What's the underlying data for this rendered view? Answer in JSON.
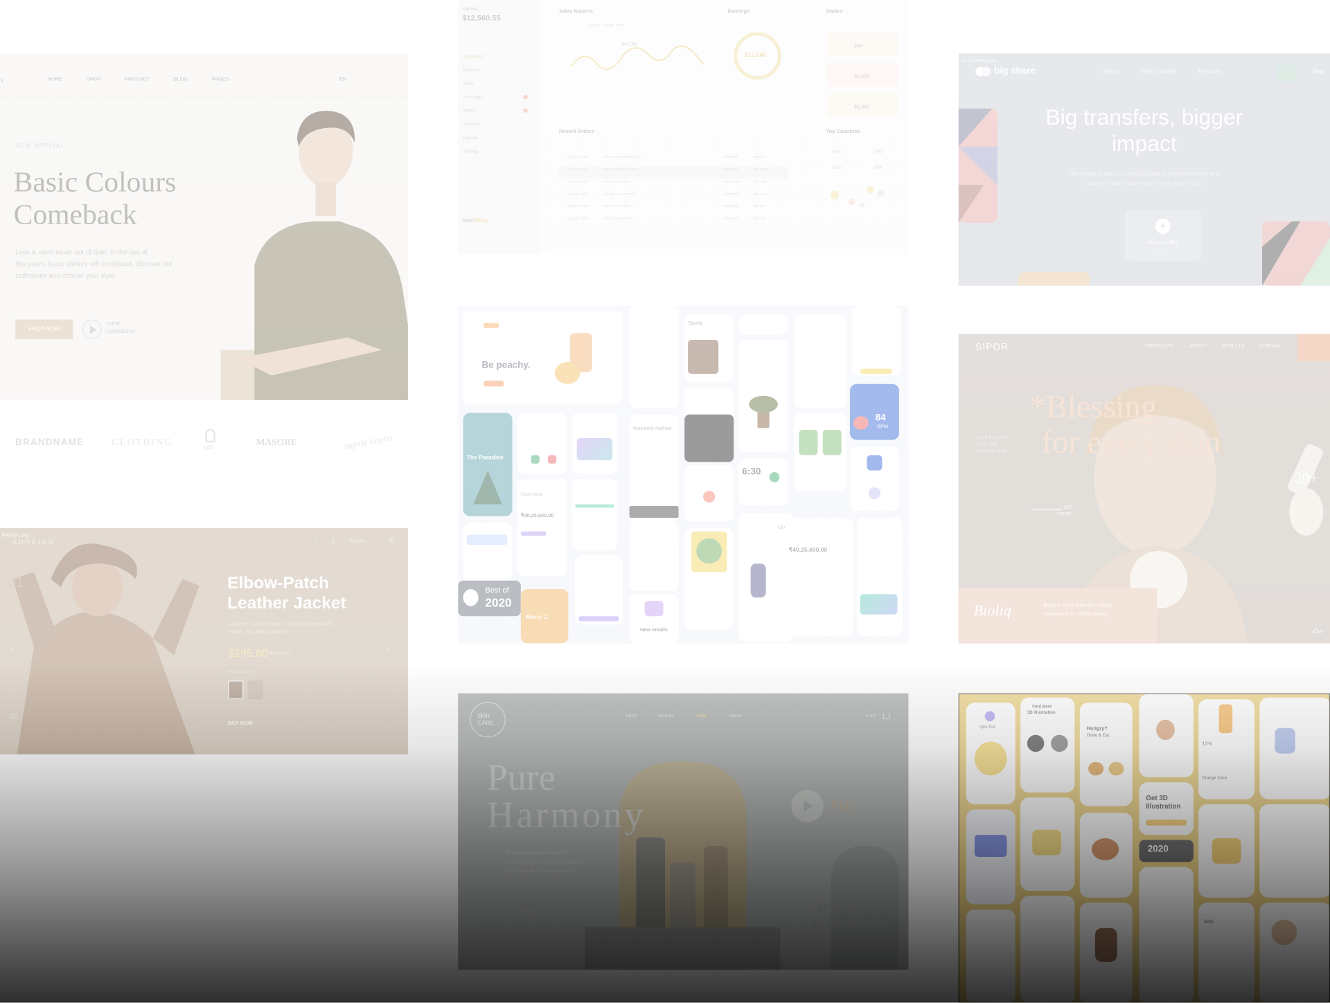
{
  "fashion": {
    "nav": [
      "HOME",
      "SHOP",
      "PRODUCT",
      "BLOG",
      "PAGES"
    ],
    "lang": "EN",
    "eyebrow": "NEW ARRIVAL",
    "title_line1": "Basic Colours",
    "title_line2": "Comeback",
    "body_l1": "Less is more never out of date. In the last of",
    "body_l2": "this years, basic colours will comeback, discover our",
    "body_l3": "collections and choose your style",
    "cta": "SHOP NOW",
    "lookbook_l1": "VIEW",
    "lookbook_l2": "LOOKBOOK",
    "brands": [
      "BRANDNAME",
      "CLOTHING",
      "gap",
      "MASORE",
      "supra unero"
    ]
  },
  "dashboard": {
    "balance_label": "Earning",
    "balance": "$12,560.55",
    "sidebar": [
      "Dashboard",
      "Products",
      "Sales",
      "Messages",
      "Orders",
      "Analytics",
      "Payouts",
      "Settings"
    ],
    "logo_a": "mart",
    "logo_b": "flexy",
    "sales_title": "Sales Reports",
    "sales_range": "Aug 15 - Aug 26, 2020",
    "peak": "$47,050",
    "earnings_title": "Earnings",
    "earnings_value": "$12,560",
    "statics_title": "Statics",
    "stats": [
      {
        "v": "254"
      },
      {
        "v": "$6,260"
      },
      {
        "v": "$2,567"
      }
    ],
    "orders_title": "Recent Orders",
    "orders_dates": [
      "Aug 15, 2020",
      "Aug 16, 2020",
      "Aug 15, 2020",
      "Aug 16, 2020",
      "Aug 15, 2020",
      "Aug 16, 2020"
    ],
    "orders_items": [
      "Green Bomber Military Ja",
      "Wanted Leather Jacket",
      "Crew Neck T-Shirt",
      "Pro Merch Crewneck",
      "Crew Neck T-Shirt",
      "Basic Graph T-shirt"
    ],
    "orders_status": [
      "Delivered",
      "Delivered",
      "In Progress",
      "Delivered",
      "Delivered",
      "Delivered"
    ],
    "orders_amount": [
      "$99.00",
      "$2,328.00",
      "$722.00",
      "$449.00",
      "$32.00",
      "$18.00"
    ],
    "countries_title": "Top Countries",
    "countries_pct": [
      "80%",
      "37%",
      "51%",
      "33%"
    ]
  },
  "share": {
    "file_tag": "Dustin Photos.png",
    "logo": "big share",
    "nav": [
      "About",
      "How it works",
      "Features"
    ],
    "signin": "Sign",
    "title_l1": "Big transfers, bigger",
    "title_l2": "impact",
    "sub_l1": "The simplest way to send big ideas around the world, and",
    "sub_l2": "discover new creative work while you're at it.",
    "add": "Add your files",
    "add_sub": "Up to 20 GB"
  },
  "collage": {
    "peachy": "Be peachy.",
    "paradise": "The Paradise",
    "overview": "Overview",
    "amount": "₹40,25,600.00",
    "sports": "Sports",
    "welcome": "Welcome Nathan",
    "best_l1": "Best of",
    "best_l2": "2020",
    "time": "6:30",
    "bpm": "84",
    "bpm_unit": "BPM",
    "new_emails": "New emails",
    "overview2": "Overview",
    "amount2": "₹40,25,600.00",
    "merry": "Merry J"
  },
  "skin": {
    "logo": "SIPOR",
    "nav": [
      "PRODUCTS",
      "ABOUT",
      "RESULTS",
      "JOURNAL"
    ],
    "title_l1": "*Blessing",
    "title_l2": "for every skin",
    "side_l1": "YOUR BEAUTY'S",
    "side_l2": "CARE FOR",
    "side_l3": "PERFECT SKIN",
    "get_l1": "GET",
    "get_l2": "YOURS",
    "badge": "20+",
    "brand": "Bioliq",
    "brand_desc_l1": "Bioliq is a our patented unique",
    "brand_desc_l2": "component for 100% beauty",
    "corner": "Our"
  },
  "jacket": {
    "file_tag": "Mockup 1.png",
    "logo": "ADORIAN",
    "cart": "$190.00",
    "title_l1": "Elbow-Patch",
    "title_l2": "Leather Jacket",
    "desc_l1": "Lambskin. Short design. 100% water-repellent",
    "desc_l2": "Suede. Buy elbow patches.",
    "price": "$195.00",
    "old_price": "$260.00",
    "more": "MORE COLORS",
    "buy": "BUY NOW",
    "slide_l": "01",
    "slide_r": "02"
  },
  "pure": {
    "logo_l1": "skin",
    "logo_l2": "CARE",
    "nav": [
      "Shop",
      "Beauty",
      "Sale",
      "About"
    ],
    "cart": "Cart",
    "title_l1": "Pure",
    "title_l2": "Harmony",
    "sub_l1": "Shop the Beauty trends for",
    "sub_l2": "customizing our Shea body butters",
    "sub_l3": "for a full rush in rush hour time",
    "play": "Play",
    "cta": "Discover",
    "tag_l1": "Anti-aging",
    "tag_l2": "neck cream"
  },
  "threed": {
    "find_l1": "Find Best",
    "find_l2": "3D illustration",
    "hungry_l1": "Hungry?",
    "hungry_l2": "Order & Eat.",
    "get_l1": "Get 3D",
    "get_l2": "Illustration",
    "year": "2020",
    "orange": "Orange Juice",
    "discount": "15%",
    "sale": "Sale",
    "name": "Qris Pot"
  }
}
